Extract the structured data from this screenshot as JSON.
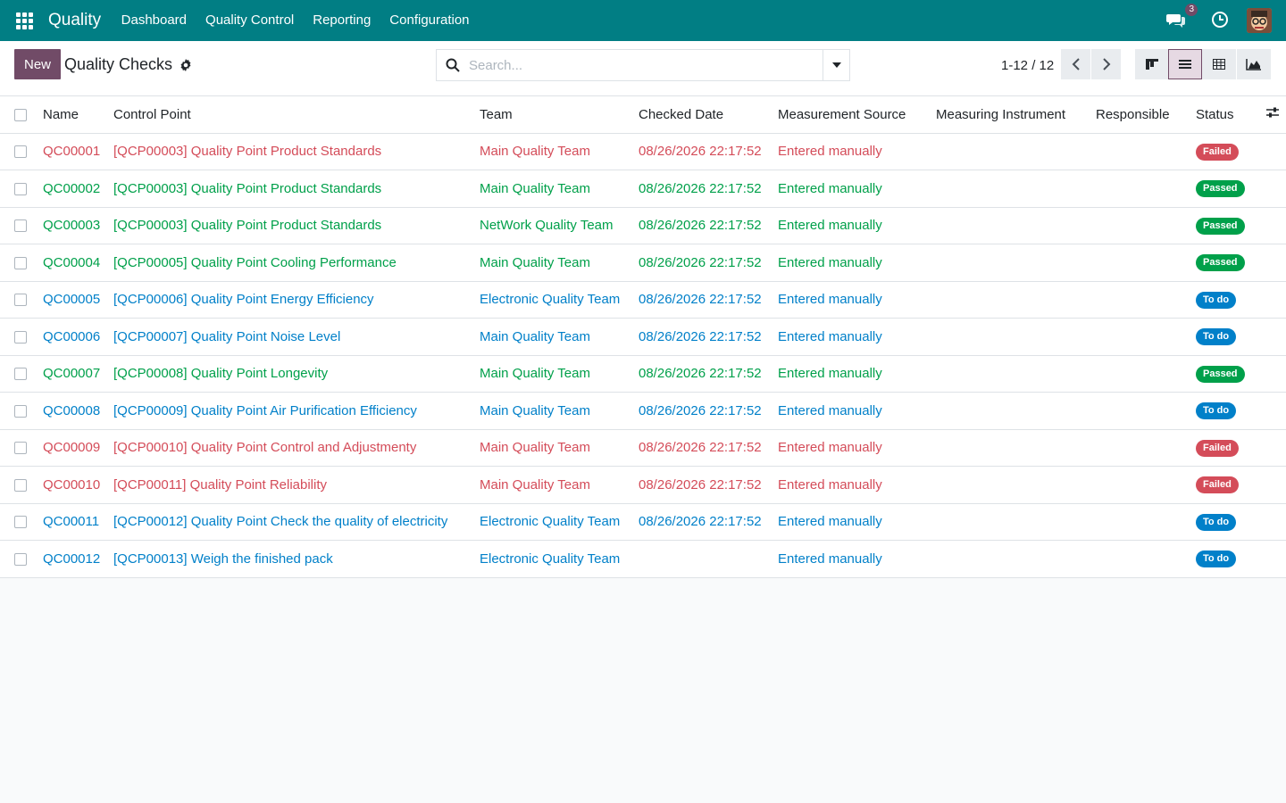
{
  "topbar": {
    "app_name": "Quality",
    "menu": [
      "Dashboard",
      "Quality Control",
      "Reporting",
      "Configuration"
    ],
    "chat_badge": "3",
    "icons": [
      "apps-icon",
      "chat-icon",
      "clock-icon",
      "avatar"
    ]
  },
  "control_panel": {
    "new_label": "New",
    "title": "Quality Checks",
    "search_placeholder": "Search...",
    "pager": "1-12 / 12",
    "views": [
      "kanban-view",
      "list-view",
      "pivot-view",
      "graph-view"
    ],
    "active_view": "list-view"
  },
  "colors": {
    "brand": "#017e84",
    "primary": "#714b67",
    "failed": "#d44c59",
    "passed": "#00a04a",
    "todo": "#0180c9"
  },
  "table": {
    "headers": [
      "Name",
      "Control Point",
      "Team",
      "Checked Date",
      "Measurement Source",
      "Measuring Instrument",
      "Responsible",
      "Status"
    ],
    "rows": [
      {
        "name": "QC00001",
        "control_point": "[QCP00003] Quality Point Product Standards",
        "team": "Main Quality Team",
        "checked_date": "08/26/2026 22:17:52",
        "source": "Entered manually",
        "instrument": "",
        "responsible": "",
        "status": "Failed",
        "tone": "failed"
      },
      {
        "name": "QC00002",
        "control_point": "[QCP00003] Quality Point Product Standards",
        "team": "Main Quality Team",
        "checked_date": "08/26/2026 22:17:52",
        "source": "Entered manually",
        "instrument": "",
        "responsible": "",
        "status": "Passed",
        "tone": "passed"
      },
      {
        "name": "QC00003",
        "control_point": "[QCP00003] Quality Point Product Standards",
        "team": "NetWork Quality Team",
        "checked_date": "08/26/2026 22:17:52",
        "source": "Entered manually",
        "instrument": "",
        "responsible": "",
        "status": "Passed",
        "tone": "passed"
      },
      {
        "name": "QC00004",
        "control_point": "[QCP00005] Quality Point Cooling Performance",
        "team": "Main Quality Team",
        "checked_date": "08/26/2026 22:17:52",
        "source": "Entered manually",
        "instrument": "",
        "responsible": "",
        "status": "Passed",
        "tone": "passed"
      },
      {
        "name": "QC00005",
        "control_point": "[QCP00006] Quality Point Energy Efficiency",
        "team": "Electronic Quality Team",
        "checked_date": "08/26/2026 22:17:52",
        "source": "Entered manually",
        "instrument": "",
        "responsible": "",
        "status": "To do",
        "tone": "todo"
      },
      {
        "name": "QC00006",
        "control_point": "[QCP00007] Quality Point Noise Level",
        "team": "Main Quality Team",
        "checked_date": "08/26/2026 22:17:52",
        "source": "Entered manually",
        "instrument": "",
        "responsible": "",
        "status": "To do",
        "tone": "todo"
      },
      {
        "name": "QC00007",
        "control_point": "[QCP00008] Quality Point Longevity",
        "team": "Main Quality Team",
        "checked_date": "08/26/2026 22:17:52",
        "source": "Entered manually",
        "instrument": "",
        "responsible": "",
        "status": "Passed",
        "tone": "passed"
      },
      {
        "name": "QC00008",
        "control_point": "[QCP00009] Quality Point Air Purification Efficiency",
        "team": "Main Quality Team",
        "checked_date": "08/26/2026 22:17:52",
        "source": "Entered manually",
        "instrument": "",
        "responsible": "",
        "status": "To do",
        "tone": "todo"
      },
      {
        "name": "QC00009",
        "control_point": "[QCP00010] Quality Point Control and Adjustmenty",
        "team": "Main Quality Team",
        "checked_date": "08/26/2026 22:17:52",
        "source": "Entered manually",
        "instrument": "",
        "responsible": "",
        "status": "Failed",
        "tone": "failed"
      },
      {
        "name": "QC00010",
        "control_point": "[QCP00011] Quality Point Reliability",
        "team": "Main Quality Team",
        "checked_date": "08/26/2026 22:17:52",
        "source": "Entered manually",
        "instrument": "",
        "responsible": "",
        "status": "Failed",
        "tone": "failed"
      },
      {
        "name": "QC00011",
        "control_point": "[QCP00012] Quality Point Check the quality of electricity",
        "team": "Electronic Quality Team",
        "checked_date": "08/26/2026 22:17:52",
        "source": "Entered manually",
        "instrument": "",
        "responsible": "",
        "status": "To do",
        "tone": "todo"
      },
      {
        "name": "QC00012",
        "control_point": "[QCP00013] Weigh the finished pack",
        "team": "Electronic Quality Team",
        "checked_date": "",
        "source": "Entered manually",
        "instrument": "",
        "responsible": "",
        "status": "To do",
        "tone": "todo"
      }
    ]
  }
}
